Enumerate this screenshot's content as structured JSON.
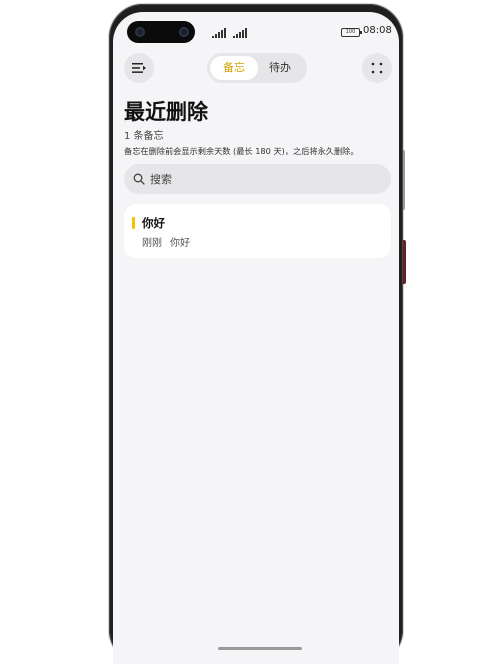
{
  "status_bar": {
    "battery": "100",
    "time": "08:08"
  },
  "toolbar": {
    "menu_icon": "menu-icon",
    "more_icon": "more-icon",
    "tabs": [
      {
        "label": "备忘",
        "active": true
      },
      {
        "label": "待办",
        "active": false
      }
    ]
  },
  "header": {
    "title": "最近删除",
    "count": "1 条备忘",
    "hint": "备忘在删除前会显示剩余天数 (最长 180 天)，之后将永久删除。"
  },
  "search": {
    "placeholder": "搜索",
    "value": ""
  },
  "notes": [
    {
      "title": "你好",
      "time": "刚刚",
      "preview": "你好"
    }
  ],
  "colors": {
    "accent": "#d1a300",
    "note_marker": "#f2c200",
    "background": "#f5f5f7"
  }
}
